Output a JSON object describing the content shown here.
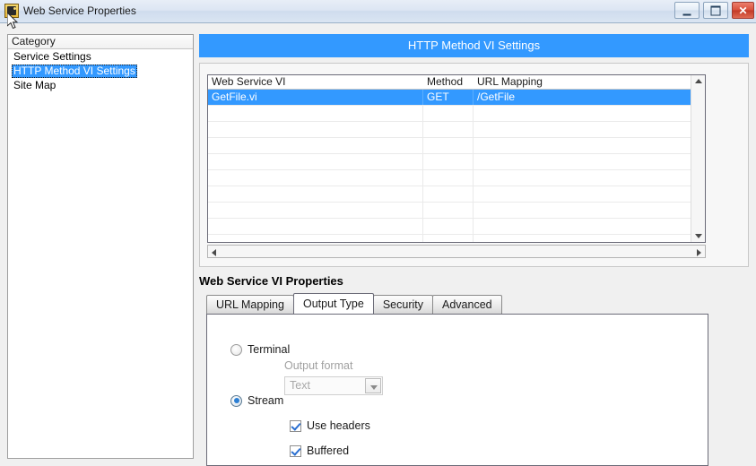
{
  "window": {
    "title": "Web Service Properties",
    "icon": "labview-app-icon",
    "controls": {
      "minimize_label": "–",
      "maximize_label": "□",
      "close_label": "✕"
    }
  },
  "sidebar": {
    "header": "Category",
    "items": [
      {
        "label": "Service Settings",
        "selected": false
      },
      {
        "label": "HTTP Method VI Settings",
        "selected": true
      },
      {
        "label": "Site Map",
        "selected": false
      }
    ]
  },
  "banner": {
    "title": "HTTP Method VI Settings",
    "color": "#3399ff"
  },
  "table": {
    "columns": [
      "Web Service VI",
      "Method",
      "URL Mapping"
    ],
    "rows": [
      {
        "vi": "GetFile.vi",
        "method": "GET",
        "url": "/GetFile",
        "selected": true
      }
    ],
    "empty_row_count": 9,
    "selection_color": "#3399ff"
  },
  "properties": {
    "title": "Web Service VI Properties",
    "tabs": [
      {
        "label": "URL Mapping",
        "active": false
      },
      {
        "label": "Output Type",
        "active": true
      },
      {
        "label": "Security",
        "active": false
      },
      {
        "label": "Advanced",
        "active": false
      }
    ],
    "output_type": {
      "terminal": {
        "label": "Terminal",
        "selected": false
      },
      "output_format": {
        "label": "Output format",
        "value": "Text",
        "enabled": false,
        "arrow_icon": "chevron-down-icon"
      },
      "stream": {
        "label": "Stream",
        "selected": true
      },
      "use_headers": {
        "label": "Use headers",
        "checked": true
      },
      "buffered": {
        "label": "Buffered",
        "checked": true
      }
    }
  },
  "scrollbars": {
    "vertical": {
      "up_icon": "arrow-up-icon",
      "down_icon": "arrow-down-icon"
    },
    "horizontal": {
      "left_icon": "arrow-left-icon",
      "right_icon": "arrow-right-icon"
    }
  }
}
